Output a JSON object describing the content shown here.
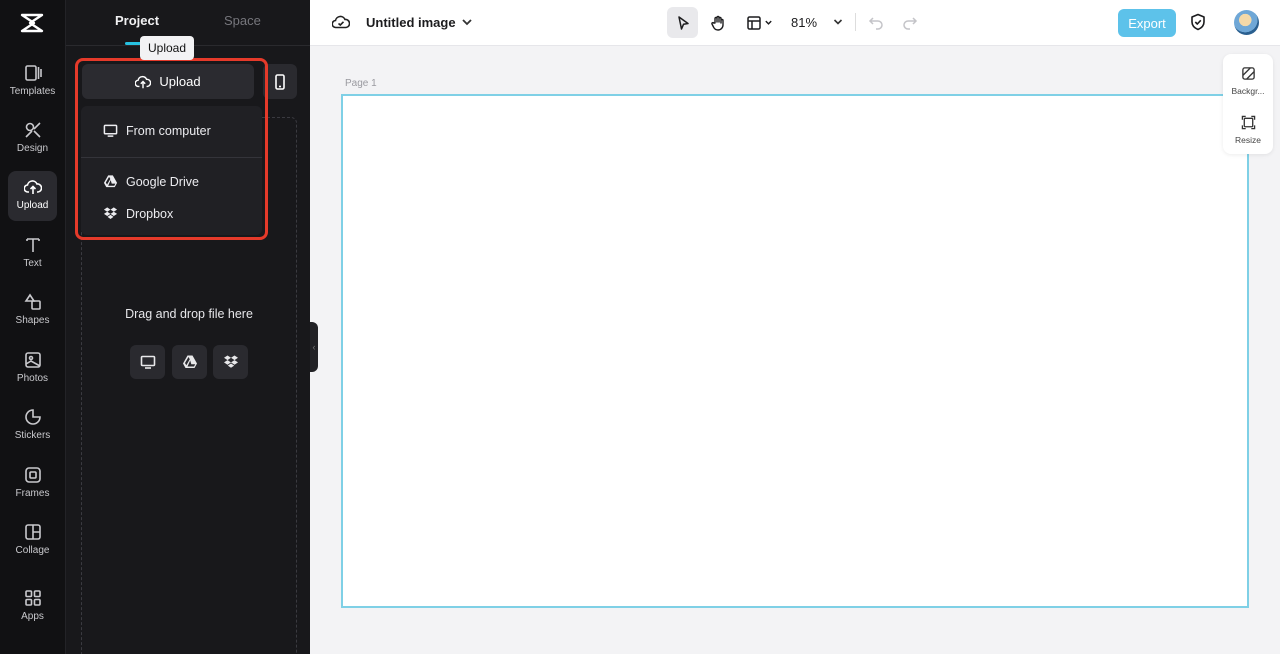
{
  "rail": {
    "items": [
      {
        "label": "Templates",
        "icon": "templates-icon"
      },
      {
        "label": "Design",
        "icon": "design-icon"
      },
      {
        "label": "Upload",
        "icon": "upload-cloud-icon",
        "active": true
      },
      {
        "label": "Text",
        "icon": "text-icon"
      },
      {
        "label": "Shapes",
        "icon": "shapes-icon"
      },
      {
        "label": "Photos",
        "icon": "photos-icon"
      },
      {
        "label": "Stickers",
        "icon": "stickers-icon"
      },
      {
        "label": "Frames",
        "icon": "frames-icon"
      },
      {
        "label": "Collage",
        "icon": "collage-icon"
      },
      {
        "label": "Apps",
        "icon": "apps-icon"
      }
    ]
  },
  "panel": {
    "tabs": {
      "project": "Project",
      "space": "Space"
    },
    "tooltip": "Upload",
    "upload_button": "Upload",
    "menu": {
      "from_computer": "From computer",
      "google_drive": "Google Drive",
      "dropbox": "Dropbox"
    },
    "dropzone_text": "Drag and drop file here"
  },
  "topbar": {
    "title": "Untitled image",
    "zoom": "81%",
    "export": "Export"
  },
  "canvas": {
    "page_label": "Page 1"
  },
  "side_panel": {
    "background": "Backgr...",
    "resize": "Resize"
  },
  "colors": {
    "accent": "#27c1e0",
    "export": "#5dc2ea",
    "highlight": "#e53a2a"
  }
}
